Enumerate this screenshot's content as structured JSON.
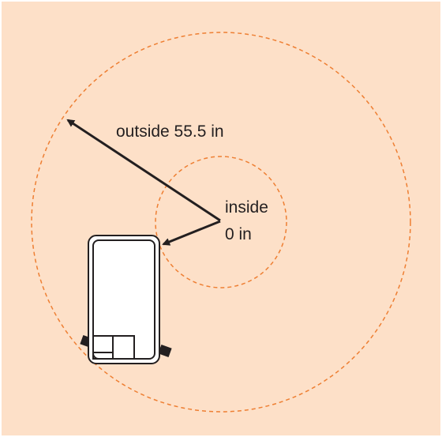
{
  "diagram": {
    "background_color": "#fde0c8",
    "ring_color": "#ee7f33",
    "line_color": "#231f20",
    "outer_label": "outside 55.5 in",
    "inner_label_line1": "inside",
    "inner_label_line2": "0 in"
  }
}
